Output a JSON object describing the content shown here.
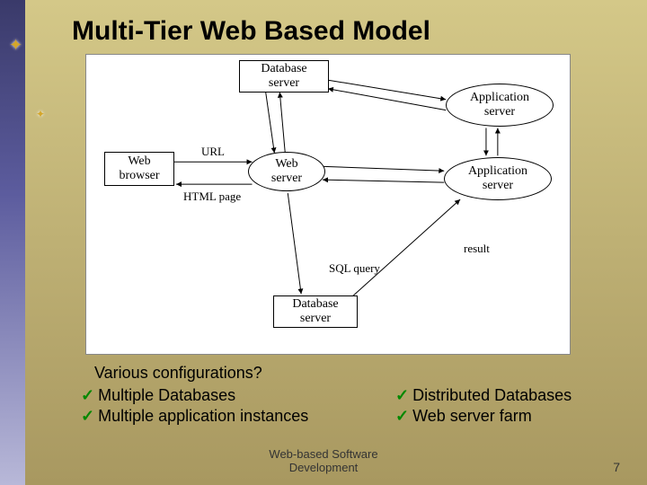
{
  "title": "Multi-Tier Web Based Model",
  "diagram": {
    "nodes": {
      "db1": "Database\nserver",
      "app1": "Application\nserver",
      "webbrowser": "Web\nbrowser",
      "webserver": "Web\nserver",
      "app2": "Application\nserver",
      "db2": "Database\nserver"
    },
    "labels": {
      "url": "URL",
      "htmlpage": "HTML page",
      "sqlquery": "SQL query",
      "result": "result"
    }
  },
  "question": "Various configurations?",
  "bullets_left": {
    "b1": "Multiple Databases",
    "b2": "Multiple application instances"
  },
  "bullets_right": {
    "b1": "Distributed Databases",
    "b2": "Web server farm"
  },
  "footer": "Web-based Software\nDevelopment",
  "pagenum": "7"
}
